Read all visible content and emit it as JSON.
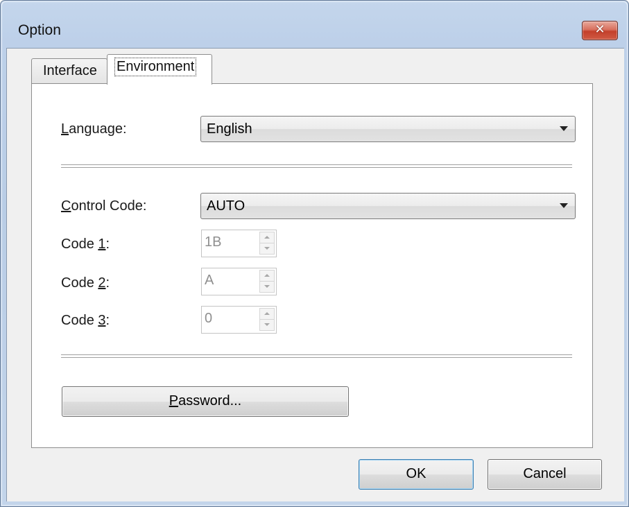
{
  "window": {
    "title": "Option",
    "close_glyph": "✕"
  },
  "tabs": [
    {
      "label": "Interface",
      "selected": false
    },
    {
      "label": "Environment",
      "selected": true
    }
  ],
  "language": {
    "label_mnemonic": "L",
    "label_rest": "anguage:",
    "value": "English"
  },
  "control_code": {
    "label_mnemonic": "C",
    "label_rest": "ontrol Code:",
    "value": "AUTO"
  },
  "codes": [
    {
      "label_prefix": "Code ",
      "mnemonic": "1",
      "suffix": ":",
      "value": "1B"
    },
    {
      "label_prefix": "Code ",
      "mnemonic": "2",
      "suffix": ":",
      "value": "A"
    },
    {
      "label_prefix": "Code ",
      "mnemonic": "3",
      "suffix": ":",
      "value": "0"
    }
  ],
  "password_button": {
    "mnemonic": "P",
    "rest": "assword..."
  },
  "footer": {
    "ok_label": "OK",
    "cancel_label": "Cancel"
  },
  "colors": {
    "frame": "#bdd0e9",
    "close_button": "#c4402b",
    "panel": "#ffffff",
    "disabled_text": "#8f8f8f"
  }
}
